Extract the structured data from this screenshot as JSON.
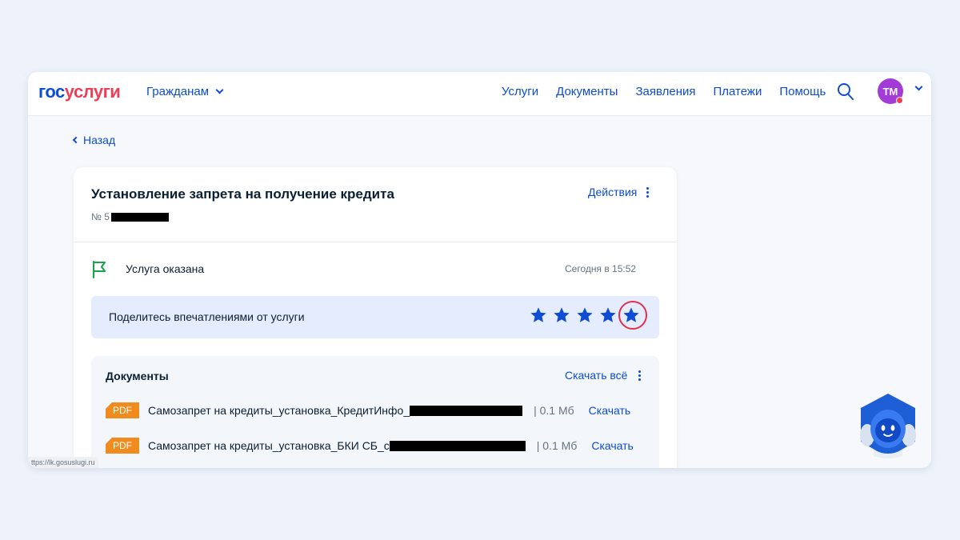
{
  "header": {
    "logo_part1": "гос",
    "logo_part2": "услуги",
    "citizens_menu": "Гражданам",
    "nav": [
      "Услуги",
      "Документы",
      "Заявления",
      "Платежи",
      "Помощь"
    ],
    "avatar_initials": "ТМ"
  },
  "back_label": "Назад",
  "application": {
    "title": "Установление запрета на получение кредита",
    "number_prefix": "№ 5",
    "actions_label": "Действия",
    "status_text": "Услуга оказана",
    "status_time": "Сегодня в 15:52"
  },
  "rating": {
    "prompt": "Поделитесь впечатлениями от услуги",
    "stars_total": 5
  },
  "documents": {
    "title": "Документы",
    "download_all": "Скачать всё",
    "items": [
      {
        "type": "PDF",
        "name": "Самозапрет на кредиты_установка_КредитИнфо_",
        "size": "| 0.1 Мб",
        "download": "Скачать"
      },
      {
        "type": "PDF",
        "name": "Самозапрет на кредиты_установка_БКИ СБ_с",
        "size": "| 0.1 Мб",
        "download": "Скачать"
      }
    ]
  },
  "status_bar_url": "ttps://lk.gosuslugi.ru",
  "colors": {
    "primary": "#0d4cd3",
    "accent_red": "#ee3f58",
    "avatar": "#a33bd6",
    "pdf_badge": "#f08c1e",
    "status_green": "#19a34a"
  }
}
